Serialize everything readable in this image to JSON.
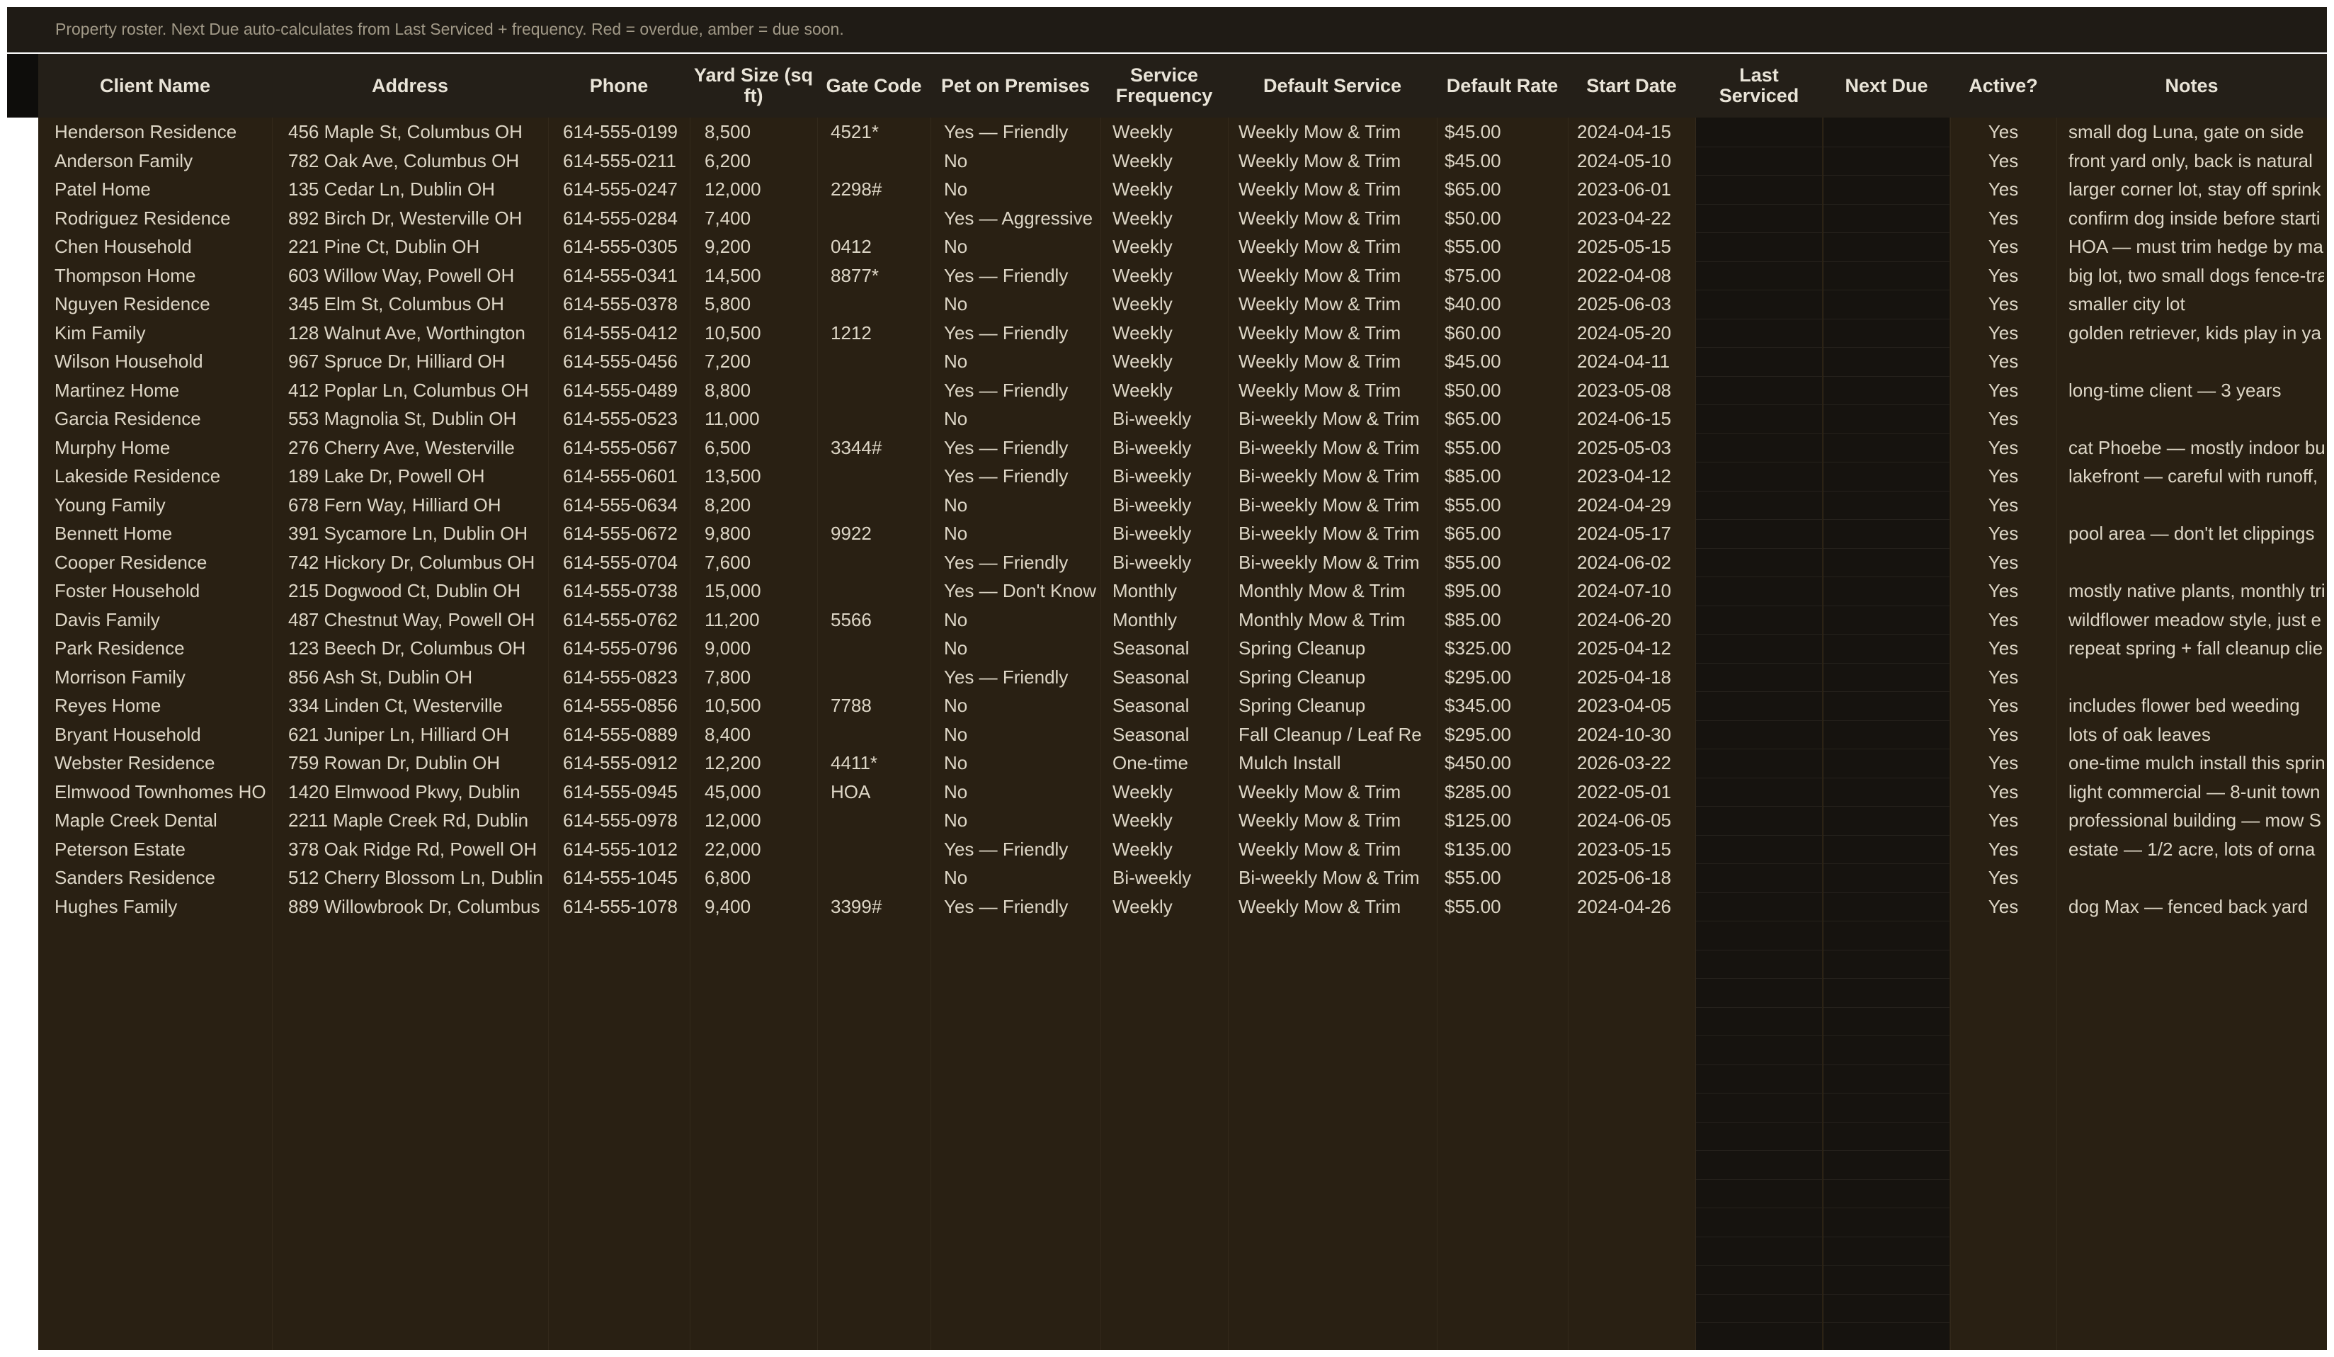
{
  "caption": "Property roster. Next Due auto-calculates from Last Serviced + frequency. Red = overdue, amber = due soon.",
  "columns": [
    {
      "key": "client",
      "label": "Client Name"
    },
    {
      "key": "address",
      "label": "Address"
    },
    {
      "key": "phone",
      "label": "Phone"
    },
    {
      "key": "yard",
      "label": "Yard Size (sq\nft)"
    },
    {
      "key": "gate",
      "label": "Gate Code"
    },
    {
      "key": "pet",
      "label": "Pet on Premises"
    },
    {
      "key": "freq",
      "label": "Service\nFrequency"
    },
    {
      "key": "service",
      "label": "Default Service"
    },
    {
      "key": "rate",
      "label": "Default Rate"
    },
    {
      "key": "start",
      "label": "Start Date"
    },
    {
      "key": "last",
      "label": "Last\nServiced"
    },
    {
      "key": "next",
      "label": "Next Due"
    },
    {
      "key": "active",
      "label": "Active?"
    },
    {
      "key": "notes",
      "label": "Notes"
    }
  ],
  "rows": [
    {
      "client": "Henderson Residence",
      "address": "456 Maple St, Columbus OH",
      "phone": "614-555-0199",
      "yard": "8,500",
      "gate": "4521*",
      "pet": "Yes — Friendly",
      "freq": "Weekly",
      "service": "Weekly Mow & Trim",
      "rate": "$45.00",
      "start": "2024-04-15",
      "last": "",
      "next": "",
      "active": "Yes",
      "notes": "small dog Luna, gate on side"
    },
    {
      "client": "Anderson Family",
      "address": "782 Oak Ave, Columbus OH",
      "phone": "614-555-0211",
      "yard": "6,200",
      "gate": "",
      "pet": "No",
      "freq": "Weekly",
      "service": "Weekly Mow & Trim",
      "rate": "$45.00",
      "start": "2024-05-10",
      "last": "",
      "next": "",
      "active": "Yes",
      "notes": "front yard only, back is natural"
    },
    {
      "client": "Patel Home",
      "address": "135 Cedar Ln, Dublin OH",
      "phone": "614-555-0247",
      "yard": "12,000",
      "gate": "2298#",
      "pet": "No",
      "freq": "Weekly",
      "service": "Weekly Mow & Trim",
      "rate": "$65.00",
      "start": "2023-06-01",
      "last": "",
      "next": "",
      "active": "Yes",
      "notes": "larger corner lot, stay off sprink"
    },
    {
      "client": "Rodriguez Residence",
      "address": "892 Birch Dr, Westerville OH",
      "phone": "614-555-0284",
      "yard": "7,400",
      "gate": "",
      "pet": "Yes — Aggressive",
      "freq": "Weekly",
      "service": "Weekly Mow & Trim",
      "rate": "$50.00",
      "start": "2023-04-22",
      "last": "",
      "next": "",
      "active": "Yes",
      "notes": "confirm dog inside before starti"
    },
    {
      "client": "Chen Household",
      "address": "221 Pine Ct, Dublin OH",
      "phone": "614-555-0305",
      "yard": "9,200",
      "gate": "0412",
      "pet": "No",
      "freq": "Weekly",
      "service": "Weekly Mow & Trim",
      "rate": "$55.00",
      "start": "2025-05-15",
      "last": "",
      "next": "",
      "active": "Yes",
      "notes": "HOA — must trim hedge by ma"
    },
    {
      "client": "Thompson Home",
      "address": "603 Willow Way, Powell OH",
      "phone": "614-555-0341",
      "yard": "14,500",
      "gate": "8877*",
      "pet": "Yes — Friendly",
      "freq": "Weekly",
      "service": "Weekly Mow & Trim",
      "rate": "$75.00",
      "start": "2022-04-08",
      "last": "",
      "next": "",
      "active": "Yes",
      "notes": "big lot, two small dogs fence-tra"
    },
    {
      "client": "Nguyen Residence",
      "address": "345 Elm St, Columbus OH",
      "phone": "614-555-0378",
      "yard": "5,800",
      "gate": "",
      "pet": "No",
      "freq": "Weekly",
      "service": "Weekly Mow & Trim",
      "rate": "$40.00",
      "start": "2025-06-03",
      "last": "",
      "next": "",
      "active": "Yes",
      "notes": "smaller city lot"
    },
    {
      "client": "Kim Family",
      "address": "128 Walnut Ave, Worthington",
      "phone": "614-555-0412",
      "yard": "10,500",
      "gate": "1212",
      "pet": "Yes — Friendly",
      "freq": "Weekly",
      "service": "Weekly Mow & Trim",
      "rate": "$60.00",
      "start": "2024-05-20",
      "last": "",
      "next": "",
      "active": "Yes",
      "notes": "golden retriever, kids play in ya"
    },
    {
      "client": "Wilson Household",
      "address": "967 Spruce Dr, Hilliard OH",
      "phone": "614-555-0456",
      "yard": "7,200",
      "gate": "",
      "pet": "No",
      "freq": "Weekly",
      "service": "Weekly Mow & Trim",
      "rate": "$45.00",
      "start": "2024-04-11",
      "last": "",
      "next": "",
      "active": "Yes",
      "notes": ""
    },
    {
      "client": "Martinez Home",
      "address": "412 Poplar Ln, Columbus OH",
      "phone": "614-555-0489",
      "yard": "8,800",
      "gate": "",
      "pet": "Yes — Friendly",
      "freq": "Weekly",
      "service": "Weekly Mow & Trim",
      "rate": "$50.00",
      "start": "2023-05-08",
      "last": "",
      "next": "",
      "active": "Yes",
      "notes": "long-time client — 3 years"
    },
    {
      "client": "Garcia Residence",
      "address": "553 Magnolia St, Dublin OH",
      "phone": "614-555-0523",
      "yard": "11,000",
      "gate": "",
      "pet": "No",
      "freq": "Bi-weekly",
      "service": "Bi-weekly Mow & Trim",
      "rate": "$65.00",
      "start": "2024-06-15",
      "last": "",
      "next": "",
      "active": "Yes",
      "notes": ""
    },
    {
      "client": "Murphy Home",
      "address": "276 Cherry Ave, Westerville",
      "phone": "614-555-0567",
      "yard": "6,500",
      "gate": "3344#",
      "pet": "Yes — Friendly",
      "freq": "Bi-weekly",
      "service": "Bi-weekly Mow & Trim",
      "rate": "$55.00",
      "start": "2025-05-03",
      "last": "",
      "next": "",
      "active": "Yes",
      "notes": "cat Phoebe — mostly indoor bu"
    },
    {
      "client": "Lakeside Residence",
      "address": "189 Lake Dr, Powell OH",
      "phone": "614-555-0601",
      "yard": "13,500",
      "gate": "",
      "pet": "Yes — Friendly",
      "freq": "Bi-weekly",
      "service": "Bi-weekly Mow & Trim",
      "rate": "$85.00",
      "start": "2023-04-12",
      "last": "",
      "next": "",
      "active": "Yes",
      "notes": "lakefront — careful with runoff,"
    },
    {
      "client": "Young Family",
      "address": "678 Fern Way, Hilliard OH",
      "phone": "614-555-0634",
      "yard": "8,200",
      "gate": "",
      "pet": "No",
      "freq": "Bi-weekly",
      "service": "Bi-weekly Mow & Trim",
      "rate": "$55.00",
      "start": "2024-04-29",
      "last": "",
      "next": "",
      "active": "Yes",
      "notes": ""
    },
    {
      "client": "Bennett Home",
      "address": "391 Sycamore Ln, Dublin OH",
      "phone": "614-555-0672",
      "yard": "9,800",
      "gate": "9922",
      "pet": "No",
      "freq": "Bi-weekly",
      "service": "Bi-weekly Mow & Trim",
      "rate": "$65.00",
      "start": "2024-05-17",
      "last": "",
      "next": "",
      "active": "Yes",
      "notes": "pool area — don't let clippings"
    },
    {
      "client": "Cooper Residence",
      "address": "742 Hickory Dr, Columbus OH",
      "phone": "614-555-0704",
      "yard": "7,600",
      "gate": "",
      "pet": "Yes — Friendly",
      "freq": "Bi-weekly",
      "service": "Bi-weekly Mow & Trim",
      "rate": "$55.00",
      "start": "2024-06-02",
      "last": "",
      "next": "",
      "active": "Yes",
      "notes": ""
    },
    {
      "client": "Foster Household",
      "address": "215 Dogwood Ct, Dublin OH",
      "phone": "614-555-0738",
      "yard": "15,000",
      "gate": "",
      "pet": "Yes — Don't Know",
      "freq": "Monthly",
      "service": "Monthly Mow & Trim",
      "rate": "$95.00",
      "start": "2024-07-10",
      "last": "",
      "next": "",
      "active": "Yes",
      "notes": "mostly native plants, monthly tri"
    },
    {
      "client": "Davis Family",
      "address": "487 Chestnut Way, Powell OH",
      "phone": "614-555-0762",
      "yard": "11,200",
      "gate": "5566",
      "pet": "No",
      "freq": "Monthly",
      "service": "Monthly Mow & Trim",
      "rate": "$85.00",
      "start": "2024-06-20",
      "last": "",
      "next": "",
      "active": "Yes",
      "notes": "wildflower meadow style, just e"
    },
    {
      "client": "Park Residence",
      "address": "123 Beech Dr, Columbus OH",
      "phone": "614-555-0796",
      "yard": "9,000",
      "gate": "",
      "pet": "No",
      "freq": "Seasonal",
      "service": "Spring Cleanup",
      "rate": "$325.00",
      "start": "2025-04-12",
      "last": "",
      "next": "",
      "active": "Yes",
      "notes": "repeat spring + fall cleanup clie"
    },
    {
      "client": "Morrison Family",
      "address": "856 Ash St, Dublin OH",
      "phone": "614-555-0823",
      "yard": "7,800",
      "gate": "",
      "pet": "Yes — Friendly",
      "freq": "Seasonal",
      "service": "Spring Cleanup",
      "rate": "$295.00",
      "start": "2025-04-18",
      "last": "",
      "next": "",
      "active": "Yes",
      "notes": ""
    },
    {
      "client": "Reyes Home",
      "address": "334 Linden Ct, Westerville",
      "phone": "614-555-0856",
      "yard": "10,500",
      "gate": "7788",
      "pet": "No",
      "freq": "Seasonal",
      "service": "Spring Cleanup",
      "rate": "$345.00",
      "start": "2023-04-05",
      "last": "",
      "next": "",
      "active": "Yes",
      "notes": "includes flower bed weeding"
    },
    {
      "client": "Bryant Household",
      "address": "621 Juniper Ln, Hilliard OH",
      "phone": "614-555-0889",
      "yard": "8,400",
      "gate": "",
      "pet": "No",
      "freq": "Seasonal",
      "service": "Fall Cleanup / Leaf Re",
      "rate": "$295.00",
      "start": "2024-10-30",
      "last": "",
      "next": "",
      "active": "Yes",
      "notes": "lots of oak leaves"
    },
    {
      "client": "Webster Residence",
      "address": "759 Rowan Dr, Dublin OH",
      "phone": "614-555-0912",
      "yard": "12,200",
      "gate": "4411*",
      "pet": "No",
      "freq": "One-time",
      "service": "Mulch Install",
      "rate": "$450.00",
      "start": "2026-03-22",
      "last": "",
      "next": "",
      "active": "Yes",
      "notes": "one-time mulch install this sprin"
    },
    {
      "client": "Elmwood Townhomes HO",
      "address": "1420 Elmwood Pkwy, Dublin",
      "phone": "614-555-0945",
      "yard": "45,000",
      "gate": "HOA",
      "pet": "No",
      "freq": "Weekly",
      "service": "Weekly Mow & Trim",
      "rate": "$285.00",
      "start": "2022-05-01",
      "last": "",
      "next": "",
      "active": "Yes",
      "notes": "light commercial — 8-unit town"
    },
    {
      "client": "Maple Creek Dental",
      "address": "2211 Maple Creek Rd, Dublin",
      "phone": "614-555-0978",
      "yard": "12,000",
      "gate": "",
      "pet": "No",
      "freq": "Weekly",
      "service": "Weekly Mow & Trim",
      "rate": "$125.00",
      "start": "2024-06-05",
      "last": "",
      "next": "",
      "active": "Yes",
      "notes": "professional building — mow S"
    },
    {
      "client": "Peterson Estate",
      "address": "378 Oak Ridge Rd, Powell OH",
      "phone": "614-555-1012",
      "yard": "22,000",
      "gate": "",
      "pet": "Yes — Friendly",
      "freq": "Weekly",
      "service": "Weekly Mow & Trim",
      "rate": "$135.00",
      "start": "2023-05-15",
      "last": "",
      "next": "",
      "active": "Yes",
      "notes": "estate — 1/2 acre, lots of orna"
    },
    {
      "client": "Sanders Residence",
      "address": "512 Cherry Blossom Ln, Dublin",
      "phone": "614-555-1045",
      "yard": "6,800",
      "gate": "",
      "pet": "No",
      "freq": "Bi-weekly",
      "service": "Bi-weekly Mow & Trim",
      "rate": "$55.00",
      "start": "2025-06-18",
      "last": "",
      "next": "",
      "active": "Yes",
      "notes": ""
    },
    {
      "client": "Hughes Family",
      "address": "889 Willowbrook Dr, Columbus",
      "phone": "614-555-1078",
      "yard": "9,400",
      "gate": "3399#",
      "pet": "Yes — Friendly",
      "freq": "Weekly",
      "service": "Weekly Mow & Trim",
      "rate": "$55.00",
      "start": "2024-04-26",
      "last": "",
      "next": "",
      "active": "Yes",
      "notes": "dog Max — fenced back yard"
    }
  ]
}
